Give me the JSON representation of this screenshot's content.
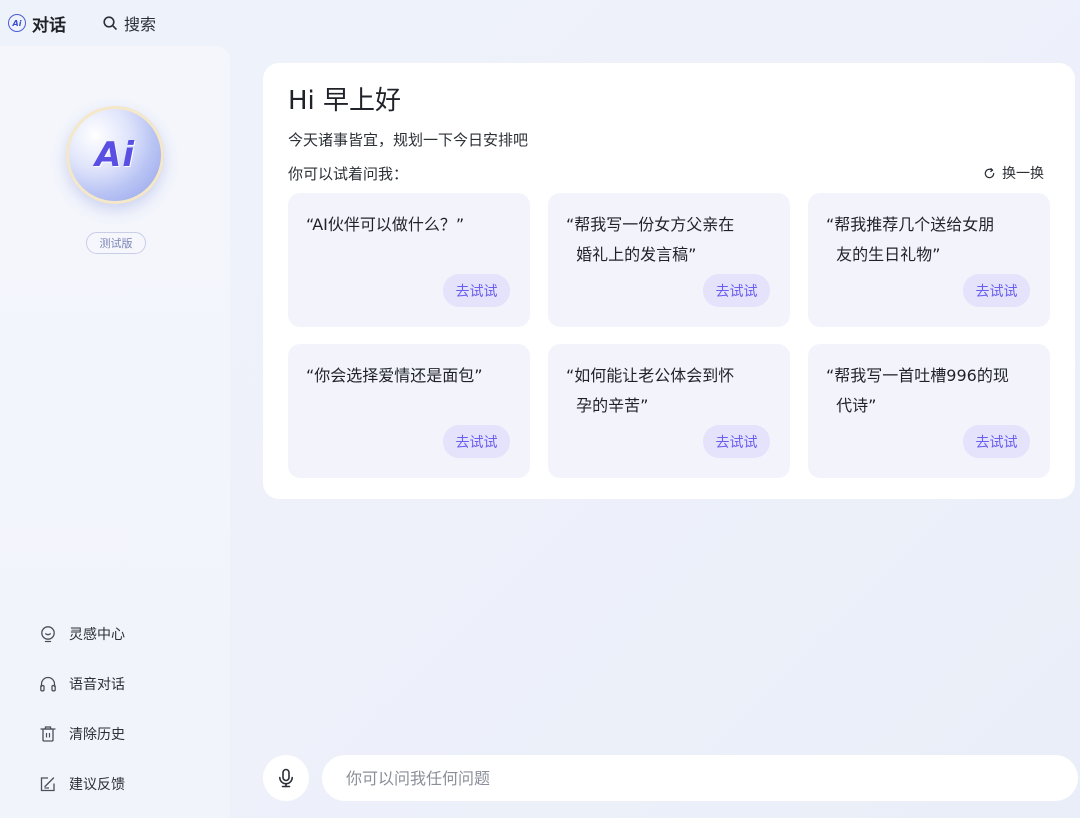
{
  "topbar": {
    "logo_text": "Ai",
    "chat_label": "对话",
    "search_label": "搜索"
  },
  "sidebar": {
    "avatar_text": "Ai",
    "badge": "测试版",
    "menu": [
      {
        "label": "灵感中心",
        "icon": "lightbulb-icon"
      },
      {
        "label": "语音对话",
        "icon": "headphones-icon"
      },
      {
        "label": "清除历史",
        "icon": "trash-icon"
      },
      {
        "label": "建议反馈",
        "icon": "feedback-icon"
      }
    ]
  },
  "main": {
    "greeting": "Hi 早上好",
    "subtitle": "今天诸事皆宜，规划一下今日安排吧",
    "try_label": "你可以试着问我：",
    "refresh_label": "换一换",
    "cards": [
      {
        "text": "“AI伙伴可以做什么？”",
        "button": "去试试"
      },
      {
        "text": "“帮我写一份女方父亲在\n  婚礼上的发言稿”",
        "button": "去试试"
      },
      {
        "text": "“帮我推荐几个送给女朋\n  友的生日礼物”",
        "button": "去试试"
      },
      {
        "text": "“你会选择爱情还是面包”",
        "button": "去试试"
      },
      {
        "text": "“如何能让老公体会到怀\n  孕的辛苦”",
        "button": "去试试"
      },
      {
        "text": "“帮我写一首吐槽996的现\n  代诗”",
        "button": "去试试"
      }
    ]
  },
  "input": {
    "placeholder": "你可以问我任何问题",
    "value": ""
  },
  "colors": {
    "accent": "#6a5ef0",
    "accent_bg": "#e4e3fb",
    "card_bg": "#f3f4fb",
    "page_bg": "#eef1fa"
  }
}
